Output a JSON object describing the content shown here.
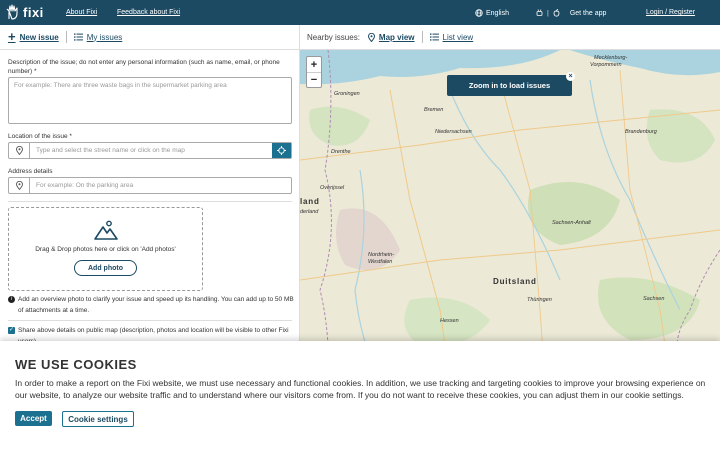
{
  "nav": {
    "logo_text": "fixi",
    "about": "About Fixi",
    "feedback": "Feedback about Fixi",
    "language": "English",
    "get_app": "Get the app",
    "login": "Login / Register"
  },
  "form": {
    "tab_new": "New issue",
    "tab_my": "My issues",
    "description_label": "Description of the issue; do not enter any personal information (such as name, email, or phone number) *",
    "description_placeholder": "For example: There are three waste bags in the supermarket parking area",
    "location_label": "Location of the issue *",
    "location_placeholder": "Type and select the street name or click on the map",
    "address_label": "Address details",
    "address_placeholder": "For example: On the parking area",
    "drop_text": "Drag & Drop photos here or click on 'Add photos'",
    "add_photo": "Add photo",
    "photo_info": "Add an overview photo to clarify your issue and speed up its handling. You can add up to 50 MB of attachments at a time.",
    "share_text": "Share above details on public map (description, photos and location will be visible to other Fixi users)"
  },
  "map": {
    "nearby_label": "Nearby issues:",
    "map_view": "Map view",
    "list_view": "List view",
    "zoom_in": "+",
    "zoom_out": "−",
    "toast": "Zoom in to load issues",
    "close": "×",
    "labels": {
      "mecklenburg": "Mecklenburg-",
      "vorpommern": "Vorpommern",
      "groningen": "Groningen",
      "bremen": "Bremen",
      "niedersachsen": "Niedersachsen",
      "brandenburg": "Brandenburg",
      "drenthe": "Drenthe",
      "overijssel": "Overijssel",
      "nederland": "derland",
      "land": "land",
      "sachsen_anhalt": "Sachsen-Anhalt",
      "nordrhein": "Nordrhein-",
      "westfalen": "Westfalen",
      "duitsland": "Duitsland",
      "thuringen": "Thüringen",
      "sachsen": "Sachsen",
      "hessen": "Hessen"
    }
  },
  "cookie": {
    "title": "WE USE COOKIES",
    "text": "In order to make a report on the Fixi website, we must use necessary and functional cookies. In addition, we use tracking and targeting cookies to improve your browsing experience on our website, to analyze our website traffic and to understand where our visitors come from. If you do not want to receive these cookies, you can adjust them in our cookie settings.",
    "accept": "Accept",
    "settings": "Cookie settings"
  },
  "colors": {
    "navbar": "#1c4a63",
    "accent": "#1c7090"
  }
}
